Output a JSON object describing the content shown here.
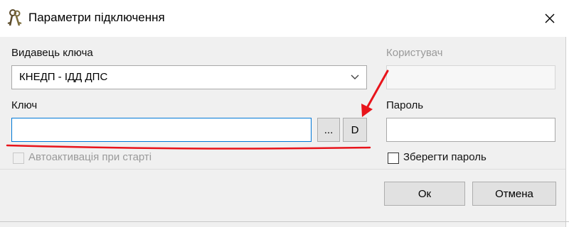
{
  "window": {
    "title": "Параметри підключення",
    "icon": "keys-icon",
    "close_icon": "close-icon"
  },
  "form": {
    "issuer": {
      "label": "Видавець ключа",
      "selected_value": "КНЕДП - ІДД ДПС"
    },
    "user": {
      "label": "Користувач",
      "value": ""
    },
    "key": {
      "label": "Ключ",
      "value": "",
      "browse_label": "...",
      "d_label": "D"
    },
    "password": {
      "label": "Пароль",
      "value": ""
    },
    "autoactivate": {
      "label": "Автоактивація при старті",
      "checked": false
    },
    "save_password": {
      "label": "Зберегти пароль",
      "checked": false
    }
  },
  "buttons": {
    "ok": "Ок",
    "cancel": "Отмена"
  },
  "annotation": {
    "color": "#e8141b"
  }
}
